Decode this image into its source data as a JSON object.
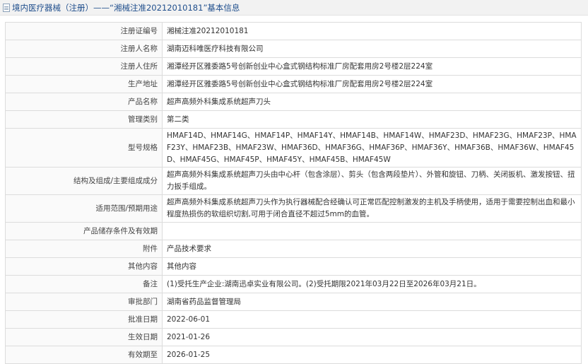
{
  "header": {
    "title": "境内医疗器械（注册）——“湘械注准20212010181”基本信息"
  },
  "rows": [
    {
      "label": "注册证编号",
      "value": "湘械注准20212010181"
    },
    {
      "label": "注册人名称",
      "value": "湖南迈科唯医疗科技有限公司"
    },
    {
      "label": "注册人住所",
      "value": "湘潭经开区雅委路5号创新创业中心盒式钢结构标准厂房配套用房2号楼2层224室"
    },
    {
      "label": "生产地址",
      "value": "湘潭经开区雅委路5号创新创业中心盒式钢结构标准厂房配套用房2号楼2层224室"
    },
    {
      "label": "产品名称",
      "value": "超声高频外科集成系统超声刀头"
    },
    {
      "label": "管理类别",
      "value": "第二类"
    },
    {
      "label": "型号规格",
      "value": "HMAF14D、HMAF14G、HMAF14P、HMAF14Y、HMAF14B、HMAF14W、HMAF23D、HMAF23G、HMAF23P、HMAF23Y、HMAF23B、HMAF23W、HMAF36D、HMAF36G、HMAF36P、HMAF36Y、HMAF36B、HMAF36W、HMAF45D、HMAF45G、HMAF45P、HMAF45Y、HMAF45B、HMAF45W"
    },
    {
      "label": "结构及组成/主要组成成分",
      "value": "超声高频外科集成系统超声刀头由中心杆（包含涂层）、剪头（包含两段垫片）、外管和旋钮、刀柄、关闭扳机、激发按钮、扭力扳手组成。"
    },
    {
      "label": "适用范围/预期用途",
      "value": "超声高频外科集成系统超声刀头作为执行器械配合经确认可正常匹配控制激发的主机及手柄使用，适用于需要控制出血和最小程度热损伤的软组织切割,可用于闭合直径不超过5mm的血管。"
    },
    {
      "label": "产品储存条件及有效期",
      "value": ""
    },
    {
      "label": "附件",
      "value": "产品技术要求"
    },
    {
      "label": "其他内容",
      "value": "其他内容"
    },
    {
      "label": "备注",
      "value": "(1)受托生产企业:湖南迅卓实业有限公司。(2)受托期限2021年03月22日至2026年03月21日。"
    },
    {
      "label": "审批部门",
      "value": "湖南省药品监督管理局"
    },
    {
      "label": "批准日期",
      "value": "2022-06-01"
    },
    {
      "label": "生效日期",
      "value": "2021-01-26"
    },
    {
      "label": "有效期至",
      "value": "2026-01-25"
    }
  ]
}
